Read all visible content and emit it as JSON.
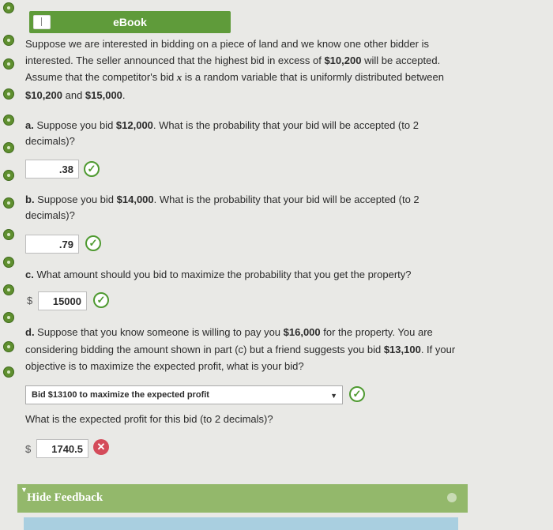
{
  "ebook": {
    "label": "eBook"
  },
  "intro": {
    "line1": "Suppose we are interested in bidding on a piece of land and we know one other bidder is",
    "line2a": "interested. The seller announced that the highest bid in excess of ",
    "line2b": "$10,200",
    "line2c": " will be accepted.",
    "line3a": "Assume that the competitor's bid ",
    "line3var": "x",
    "line3b": " is a random variable that is uniformly distributed between",
    "line4a": "$10,200",
    "line4b": " and ",
    "line4c": "$15,000",
    "line4d": "."
  },
  "part_a": {
    "prefix": "a.",
    "q1": " Suppose you bid ",
    "bid": "$12,000",
    "q2": ". What is the probability that your bid will be accepted (to 2",
    "q3": "decimals)?",
    "answer": ".38"
  },
  "part_b": {
    "prefix": "b.",
    "q1": " Suppose you bid ",
    "bid": "$14,000",
    "q2": ". What is the probability that your bid will be accepted (to 2",
    "q3": "decimals)?",
    "answer": ".79"
  },
  "part_c": {
    "prefix": "c.",
    "q": " What amount should you bid to maximize the probability that you get the property?",
    "currency": "$",
    "answer": "15000"
  },
  "part_d": {
    "prefix": "d.",
    "l1a": " Suppose that you know someone is willing to pay you ",
    "l1b": "$16,000",
    "l1c": " for the property. You are",
    "l2a": "considering bidding the amount shown in part (c) but a friend suggests you bid ",
    "l2b": "$13,100",
    "l2c": ". If your",
    "l3": "objective is to maximize the expected profit, what is your bid?",
    "select_value": "Bid $13100 to maximize the expected profit",
    "q2": "What is the expected profit for this bid (to 2 decimals)?",
    "currency": "$",
    "answer": "1740.5"
  },
  "feedback": {
    "label": "Hide Feedback"
  },
  "colors": {
    "green": "#5f9b3a",
    "check": "#4f9a31",
    "error": "#d44b5a",
    "feedback": "#93b86b"
  },
  "icons": {
    "ebook": "book-icon",
    "correct": "check-circle-icon",
    "incorrect": "x-circle-icon",
    "dropdown": "caret-down-icon"
  }
}
